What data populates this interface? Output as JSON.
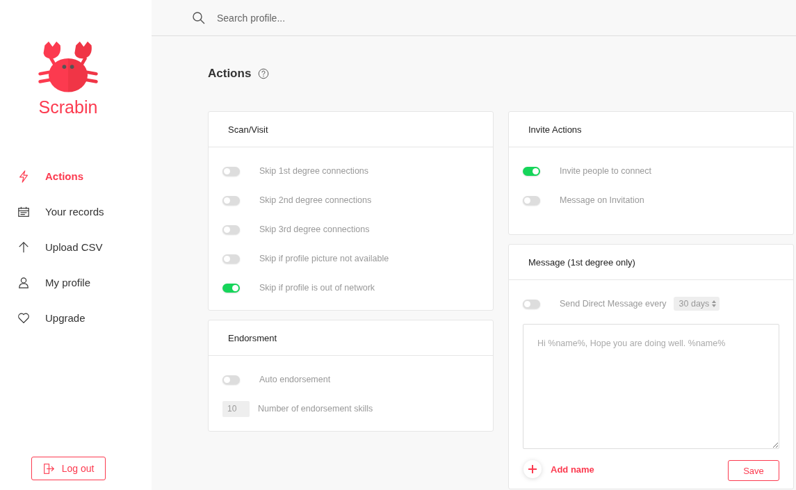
{
  "brand": {
    "name": "Scrabin"
  },
  "nav": [
    {
      "label": "Actions",
      "selected": true
    },
    {
      "label": "Your records",
      "selected": false
    },
    {
      "label": "Upload CSV",
      "selected": false
    },
    {
      "label": "My profile",
      "selected": false
    },
    {
      "label": "Upgrade",
      "selected": false
    }
  ],
  "logout": {
    "label": "Log out"
  },
  "search": {
    "placeholder": "Search profile..."
  },
  "page_title": "Actions",
  "left_cards": [
    {
      "title": "Scan/Visit",
      "rows": [
        {
          "kind": "toggle",
          "label": "Skip 1st degree connections",
          "on": false
        },
        {
          "kind": "toggle",
          "label": "Skip 2nd degree connections",
          "on": false
        },
        {
          "kind": "toggle",
          "label": "Skip 3rd degree connections",
          "on": false
        },
        {
          "kind": "toggle",
          "label": "Skip if profile picture not available",
          "on": false
        },
        {
          "kind": "toggle",
          "label": "Skip if profile is out of network",
          "on": true
        }
      ]
    },
    {
      "title": "Endorsment",
      "rows": [
        {
          "kind": "toggle",
          "label": "Auto endorsement",
          "on": false
        },
        {
          "kind": "number",
          "label": "Number of endorsement skills",
          "value": "10"
        }
      ]
    }
  ],
  "invite": {
    "title": "Invite Actions",
    "rows": [
      {
        "label": "Invite people to connect",
        "on": true
      },
      {
        "label": "Message on Invitation",
        "on": false
      }
    ]
  },
  "message": {
    "title": "Message (1st degree only)",
    "toggle": {
      "label": "Send Direct Message every",
      "on": false,
      "interval": "30 days"
    },
    "placeholder": "Hi %name%, Hope you are doing well. %name%",
    "add_label": "Add name",
    "save_label": "Save"
  }
}
